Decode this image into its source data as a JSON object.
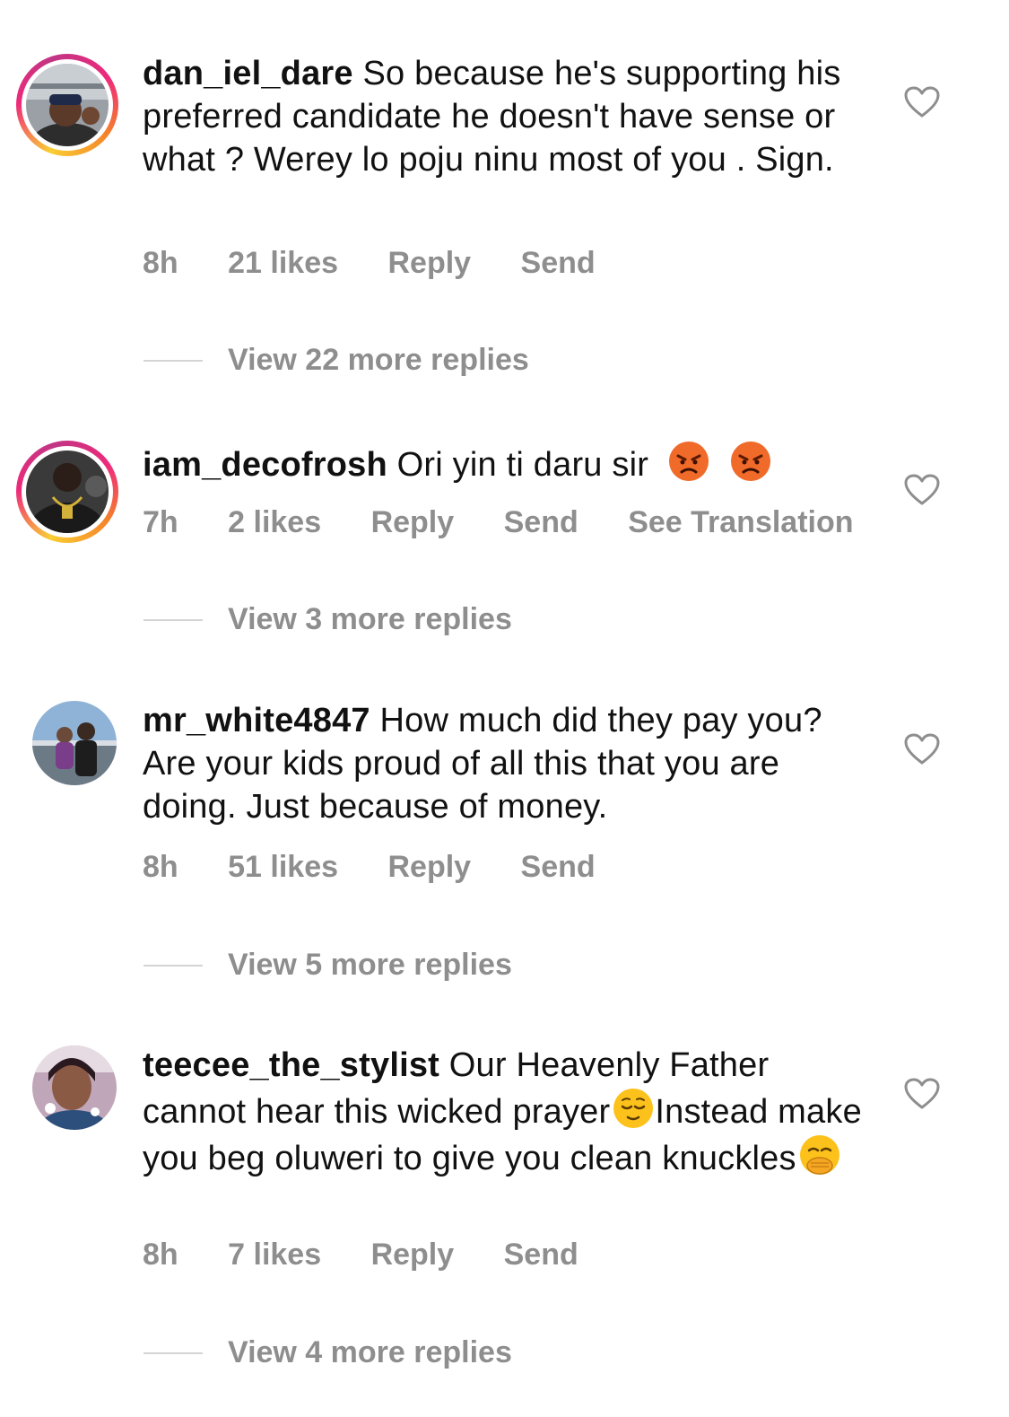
{
  "comments": [
    {
      "username": "dan_iel_dare",
      "text": "So because he's supporting his preferred candidate he doesn't have sense or what ? Werey lo poju ninu most of you . Sign.",
      "time": "8h",
      "likes": "21 likes",
      "reply": "Reply",
      "send": "Send",
      "view_replies": "View 22 more replies",
      "story_ring": true
    },
    {
      "username": "iam_decofrosh",
      "text": "Ori yin ti daru sir",
      "emojis": [
        "angry-face",
        "angry-face"
      ],
      "time": "7h",
      "likes": "2 likes",
      "reply": "Reply",
      "send": "Send",
      "translate": "See Translation",
      "view_replies": "View 3 more replies",
      "story_ring": true
    },
    {
      "username": "mr_white4847",
      "text": "How much did they pay you?  Are your kids proud of all this that you are doing. Just because of money.",
      "time": "8h",
      "likes": "51 likes",
      "reply": "Reply",
      "send": "Send",
      "view_replies": "View 5 more replies",
      "story_ring": false
    },
    {
      "username": "teecee_the_stylist",
      "text_part1": "Our Heavenly Father cannot hear this wicked prayer",
      "emoji1": "relieved-face",
      "text_part2": "Instead make you beg oluweri to give you clean knuckles",
      "emoji2": "face-with-hand-over-mouth",
      "time": "8h",
      "likes": "7 likes",
      "reply": "Reply",
      "send": "Send",
      "view_replies": "View 4 more replies",
      "story_ring": false
    }
  ],
  "colors": {
    "meta_gray": "#8e8e8e",
    "text": "#111111",
    "divider": "#d4d4d4"
  }
}
